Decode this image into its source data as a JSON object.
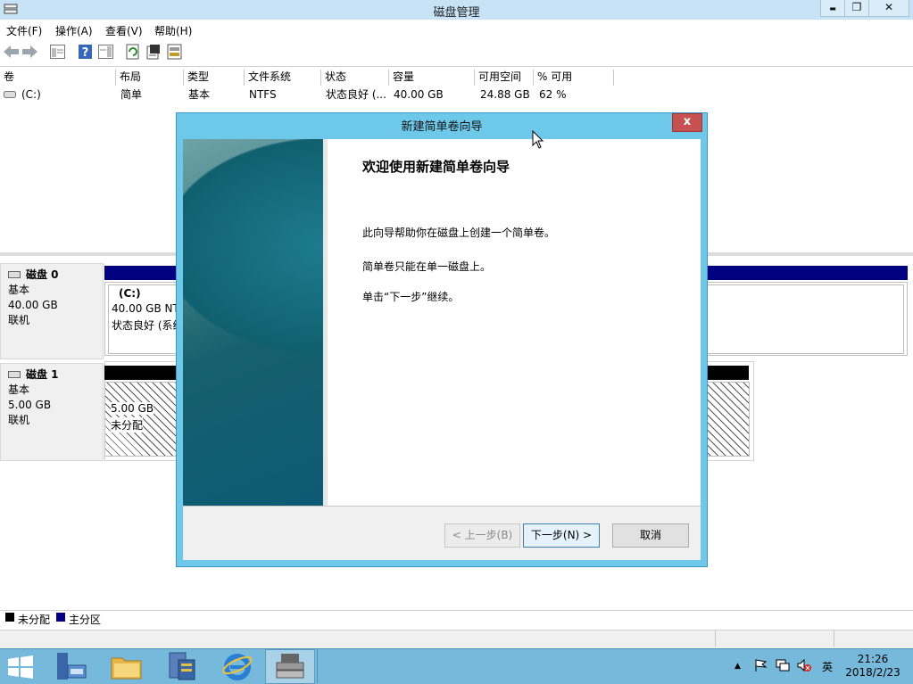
{
  "window": {
    "title": "磁盘管理",
    "min_glyph": "▬",
    "max_glyph": "❐",
    "close_glyph": "✕"
  },
  "menu": [
    "文件(F)",
    "操作(A)",
    "查看(V)",
    "帮助(H)"
  ],
  "toolbar_icons": [
    "back-arrow-icon",
    "forward-arrow-icon",
    "console-tree-icon",
    "help-icon",
    "show-action-pane-icon",
    "refresh-icon",
    "properties-icon",
    "disk-settings-icon"
  ],
  "volume_table": {
    "columns": [
      "卷",
      "布局",
      "类型",
      "文件系统",
      "状态",
      "容量",
      "可用空间",
      "% 可用"
    ],
    "rows": [
      {
        "volume": "(C:)",
        "layout": "简单",
        "type": "基本",
        "fs": "NTFS",
        "status": "状态良好 (...",
        "capacity": "40.00 GB",
        "free": "24.88 GB",
        "pct": "62 %"
      }
    ]
  },
  "disks": [
    {
      "name": "磁盘 0",
      "type": "基本",
      "size": "40.00 GB",
      "state": "联机",
      "partition": {
        "label": "(C:)",
        "line1": "40.00 GB NTFS",
        "line2": "状态良好 (系统"
      }
    },
    {
      "name": "磁盘 1",
      "type": "基本",
      "size": "5.00 GB",
      "state": "联机",
      "partition": {
        "line1": "5.00 GB",
        "line2": "未分配"
      }
    }
  ],
  "legend": [
    {
      "label": "未分配",
      "color": "#000000"
    },
    {
      "label": "主分区",
      "color": "#000080"
    }
  ],
  "dialog": {
    "title": "新建简单卷向导",
    "close_glyph": "x",
    "heading": "欢迎使用新建简单卷向导",
    "p1": "此向导帮助你在磁盘上创建一个简单卷。",
    "p2": "简单卷只能在单一磁盘上。",
    "p3": "单击“下一步”继续。",
    "back": "< 上一步(B)",
    "next": "下一步(N) >",
    "cancel": "取消"
  },
  "taskbar": {
    "apps": [
      "start-icon",
      "server-manager-icon",
      "file-explorer-icon",
      "powershell-icon",
      "internet-explorer-icon",
      "disk-management-icon"
    ],
    "tray_arrow": "▲",
    "ime": "英",
    "time": "21:26",
    "date": "2018/2/23"
  }
}
